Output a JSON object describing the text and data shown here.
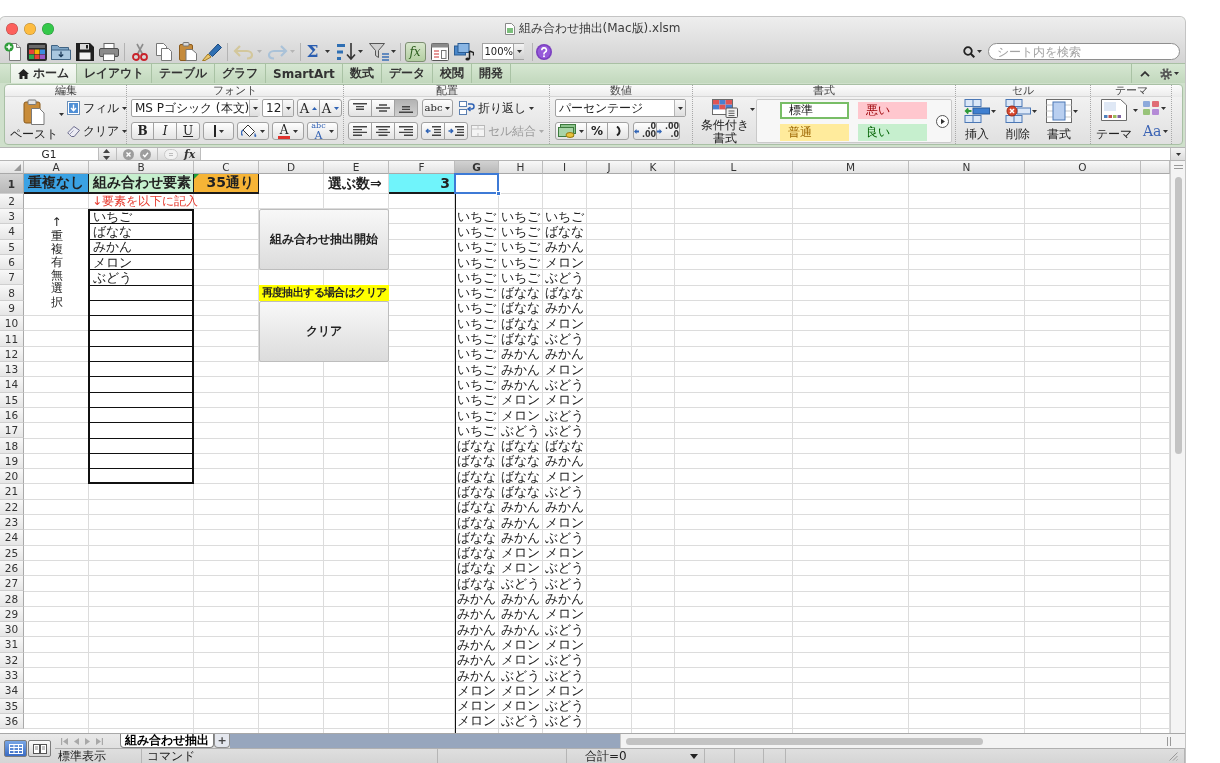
{
  "window": {
    "title": "組み合わせ抽出(Mac版).xlsm"
  },
  "toolbar": {
    "autosum": "Σ",
    "formula_builder": {
      "label": "fx",
      "on": true
    },
    "zoom": "100%"
  },
  "search": {
    "placeholder": "シート内を検索"
  },
  "ribbon_tabs": [
    {
      "label": "ホーム",
      "selected": true
    },
    {
      "label": "レイアウト",
      "selected": false
    },
    {
      "label": "テーブル",
      "selected": false
    },
    {
      "label": "グラフ",
      "selected": false
    },
    {
      "label": "SmartArt",
      "selected": false
    },
    {
      "label": "数式",
      "selected": false
    },
    {
      "label": "データ",
      "selected": false
    },
    {
      "label": "校閲",
      "selected": false
    },
    {
      "label": "開発",
      "selected": false
    }
  ],
  "ribbon": {
    "edit": {
      "title": "編集",
      "paste": "ペースト",
      "fill": "フィル",
      "clear": "クリア"
    },
    "font": {
      "title": "フォント",
      "name": "MS Pゴシック (本文)",
      "size": "12",
      "grow": "A",
      "shrink": "A",
      "bold": "B",
      "italic": "I",
      "underline": "U",
      "font_color": "A",
      "text_effects": {
        "top": "abc",
        "bottom": "A"
      }
    },
    "alignment": {
      "title": "配置",
      "vertical": [
        {
          "selected": false
        },
        {
          "selected": false
        },
        {
          "selected": true
        }
      ],
      "orientation": "abc",
      "wrap": "折り返し",
      "merge": {
        "label": "セル結合",
        "disabled": true
      }
    },
    "number": {
      "title": "数値",
      "format": "パーセンテージ",
      "percent": "%",
      "increase_decimal": {
        "top": ".0",
        "bottom": ".00"
      },
      "decrease_decimal": {
        "top": ".00",
        "bottom": ".0"
      }
    },
    "format": {
      "title": "書式",
      "conditional": [
        "条件付き",
        "書式"
      ],
      "styles": [
        {
          "label": "標準",
          "kind": "normal"
        },
        {
          "label": "悪い",
          "kind": "bad"
        },
        {
          "label": "普通",
          "kind": "neutral"
        },
        {
          "label": "良い",
          "kind": "good"
        }
      ]
    },
    "cells": {
      "title": "セル",
      "insert": "挿入",
      "delete": "削除",
      "format": "書式"
    },
    "themes": {
      "title": "テーマ",
      "theme": "テーマ",
      "fonts": "Aa"
    }
  },
  "formula_bar": {
    "name_box": "G1",
    "function": "fx"
  },
  "sheet": {
    "columns": [
      {
        "label": "A",
        "selected": false
      },
      {
        "label": "B",
        "selected": false
      },
      {
        "label": "C",
        "selected": false
      },
      {
        "label": "D",
        "selected": false
      },
      {
        "label": "E",
        "selected": false
      },
      {
        "label": "F",
        "selected": false
      },
      {
        "label": "G",
        "selected": true
      },
      {
        "label": "H",
        "selected": false
      },
      {
        "label": "I",
        "selected": false
      },
      {
        "label": "J",
        "selected": false
      },
      {
        "label": "K",
        "selected": false
      },
      {
        "label": "L",
        "selected": false
      },
      {
        "label": "M",
        "selected": false
      },
      {
        "label": "N",
        "selected": false
      },
      {
        "label": "O",
        "selected": false
      }
    ],
    "rows": [
      {
        "label": "1",
        "selected": true
      },
      {
        "label": "2",
        "selected": false
      },
      {
        "label": "3",
        "selected": false
      },
      {
        "label": "4",
        "selected": false
      },
      {
        "label": "5",
        "selected": false
      },
      {
        "label": "6",
        "selected": false
      },
      {
        "label": "7",
        "selected": false
      },
      {
        "label": "8",
        "selected": false
      },
      {
        "label": "9",
        "selected": false
      },
      {
        "label": "10",
        "selected": false
      },
      {
        "label": "11",
        "selected": false
      },
      {
        "label": "12",
        "selected": false
      },
      {
        "label": "13",
        "selected": false
      },
      {
        "label": "14",
        "selected": false
      },
      {
        "label": "15",
        "selected": false
      },
      {
        "label": "16",
        "selected": false
      },
      {
        "label": "17",
        "selected": false
      },
      {
        "label": "18",
        "selected": false
      },
      {
        "label": "19",
        "selected": false
      },
      {
        "label": "20",
        "selected": false
      },
      {
        "label": "21",
        "selected": false
      },
      {
        "label": "22",
        "selected": false
      },
      {
        "label": "23",
        "selected": false
      },
      {
        "label": "24",
        "selected": false
      },
      {
        "label": "25",
        "selected": false
      },
      {
        "label": "26",
        "selected": false
      },
      {
        "label": "27",
        "selected": false
      },
      {
        "label": "28",
        "selected": false
      },
      {
        "label": "29",
        "selected": false
      },
      {
        "label": "30",
        "selected": false
      },
      {
        "label": "31",
        "selected": false
      },
      {
        "label": "32",
        "selected": false
      },
      {
        "label": "33",
        "selected": false
      },
      {
        "label": "34",
        "selected": false
      },
      {
        "label": "35",
        "selected": false
      },
      {
        "label": "36",
        "selected": false
      }
    ],
    "header_cells": [
      {
        "text": "重複なし",
        "color": "#3aa2e4"
      },
      {
        "text": "組み合わせ要素",
        "color": "#c6efce"
      },
      {
        "text": "35通り",
        "color": "#f6b436"
      },
      {
        "text": "選ぶ数⇒"
      },
      {
        "text": "3",
        "color": "#70f4fb"
      }
    ],
    "note": "↓要素を以下に記入",
    "side_label": "↑重複有無選択",
    "elements": [
      "いちご",
      "ばなな",
      "みかん",
      "メロン",
      "ぶどう"
    ],
    "start_button": "組み合わせ抽出開始",
    "clear_note": "再度抽出する場合はクリア",
    "clear_button": "クリア",
    "results": [
      [
        "いちご",
        "いちご",
        "いちご"
      ],
      [
        "いちご",
        "いちご",
        "ばなな"
      ],
      [
        "いちご",
        "いちご",
        "みかん"
      ],
      [
        "いちご",
        "いちご",
        "メロン"
      ],
      [
        "いちご",
        "いちご",
        "ぶどう"
      ],
      [
        "いちご",
        "ばなな",
        "ばなな"
      ],
      [
        "いちご",
        "ばなな",
        "みかん"
      ],
      [
        "いちご",
        "ばなな",
        "メロン"
      ],
      [
        "いちご",
        "ばなな",
        "ぶどう"
      ],
      [
        "いちご",
        "みかん",
        "みかん"
      ],
      [
        "いちご",
        "みかん",
        "メロン"
      ],
      [
        "いちご",
        "みかん",
        "ぶどう"
      ],
      [
        "いちご",
        "メロン",
        "メロン"
      ],
      [
        "いちご",
        "メロン",
        "ぶどう"
      ],
      [
        "いちご",
        "ぶどう",
        "ぶどう"
      ],
      [
        "ばなな",
        "ばなな",
        "ばなな"
      ],
      [
        "ばなな",
        "ばなな",
        "みかん"
      ],
      [
        "ばなな",
        "ばなな",
        "メロン"
      ],
      [
        "ばなな",
        "ばなな",
        "ぶどう"
      ],
      [
        "ばなな",
        "みかん",
        "みかん"
      ],
      [
        "ばなな",
        "みかん",
        "メロン"
      ],
      [
        "ばなな",
        "みかん",
        "ぶどう"
      ],
      [
        "ばなな",
        "メロン",
        "メロン"
      ],
      [
        "ばなな",
        "メロン",
        "ぶどう"
      ],
      [
        "ばなな",
        "ぶどう",
        "ぶどう"
      ],
      [
        "みかん",
        "みかん",
        "みかん"
      ],
      [
        "みかん",
        "みかん",
        "メロン"
      ],
      [
        "みかん",
        "みかん",
        "ぶどう"
      ],
      [
        "みかん",
        "メロン",
        "メロン"
      ],
      [
        "みかん",
        "メロン",
        "ぶどう"
      ],
      [
        "みかん",
        "ぶどう",
        "ぶどう"
      ],
      [
        "メロン",
        "メロン",
        "メロン"
      ],
      [
        "メロン",
        "メロン",
        "ぶどう"
      ],
      [
        "メロン",
        "ぶどう",
        "ぶどう"
      ]
    ]
  },
  "sheet_tabs": [
    {
      "label": "組み合わせ抽出",
      "selected": true
    }
  ],
  "add_sheet": "+",
  "view_buttons": [
    {
      "selected": true
    },
    {
      "selected": false
    }
  ],
  "status_bar": {
    "view": "標準表示",
    "mode": "コマンド",
    "sum": "合計=0"
  }
}
